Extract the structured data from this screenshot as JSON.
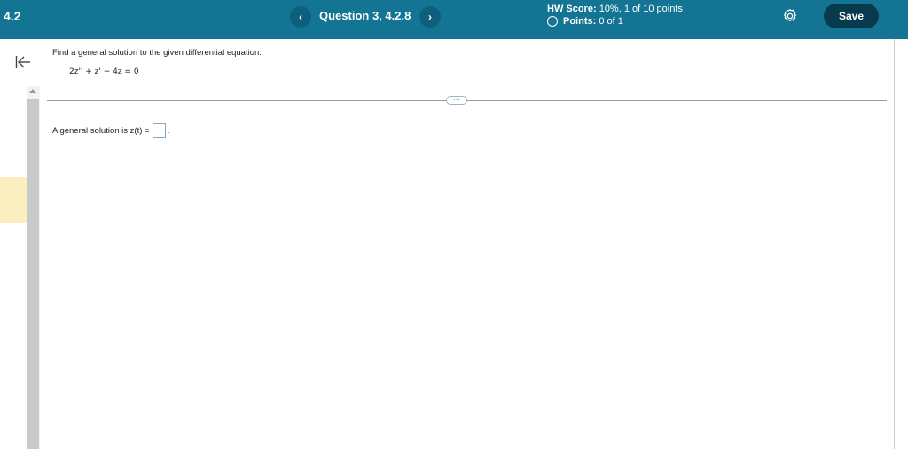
{
  "header": {
    "section": "4.2",
    "prev_icon": "‹",
    "next_icon": "›",
    "question": "Question 3, 4.2.8",
    "hw_score_label": "HW Score:",
    "hw_score_value": "10%, 1 of 10 points",
    "points_label": "Points:",
    "points_value": "0 of 1",
    "save_label": "Save",
    "settings_icon": "gear-icon"
  },
  "sidebar": {
    "collapse_icon": "collapse-left-icon"
  },
  "question": {
    "prompt": "Find a general solution to the given differential equation.",
    "equation": "2z'' + z' − 4z = 0",
    "more_indicator": "⋯",
    "answer_prefix": "A general solution is z(t) =",
    "answer_value": "",
    "answer_suffix": "."
  }
}
